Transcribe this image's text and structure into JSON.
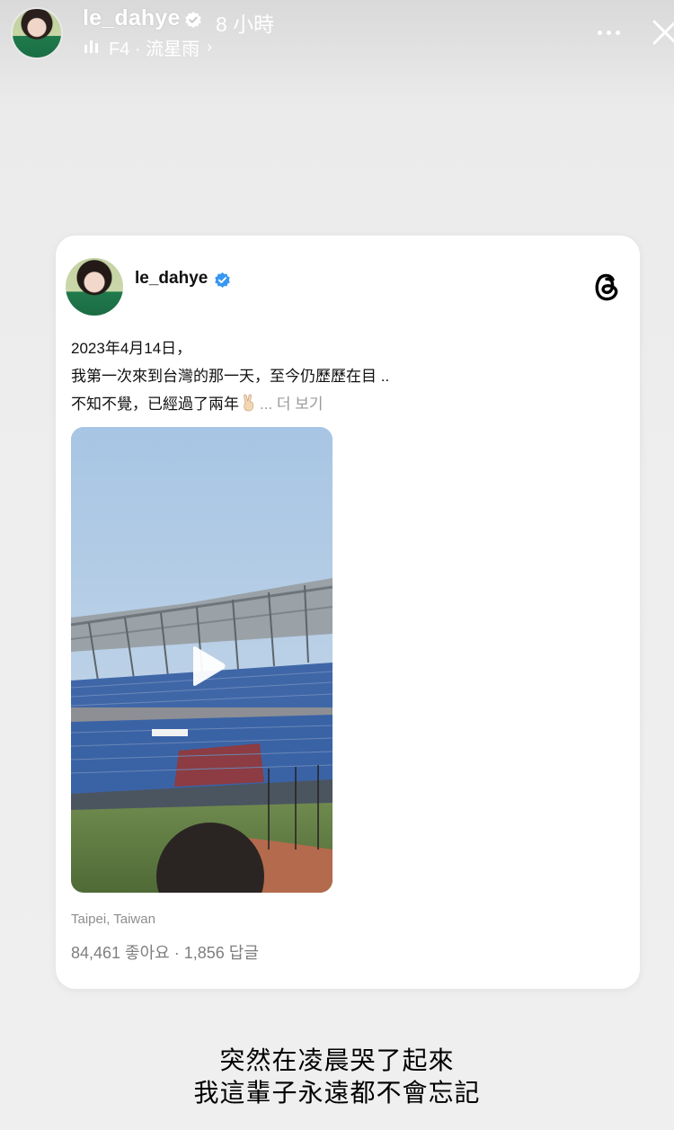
{
  "story_header": {
    "username": "le_dahye",
    "time_ago": "8 小時",
    "music_label": "F4 · 流星雨",
    "music_chevron": "›"
  },
  "card": {
    "username": "le_dahye",
    "post_lines": [
      "2023年4月14日，",
      "我第一次來到台灣的那一天，至今仍歷歷在目 ..",
      "不知不覺，已經過了兩年"
    ],
    "see_more": "... 더 보기",
    "location": "Taipei, Taiwan",
    "stats": "84,461 좋아요 · 1,856 답글"
  },
  "caption": {
    "line1": "突然在凌晨哭了起來",
    "line2": "我這輩子永遠都不會忘記"
  },
  "icons": {
    "verified": "verified-badge-icon",
    "threads": "threads-logo-icon",
    "play": "play-icon",
    "more": "more-dots-icon",
    "close": "close-icon",
    "music": "music-bars-icon",
    "peace": "peace-hand-emoji"
  },
  "colors": {
    "verified_blue": "#3797f0",
    "muted_text": "#8e8e8e",
    "background": "#eeeeee"
  }
}
